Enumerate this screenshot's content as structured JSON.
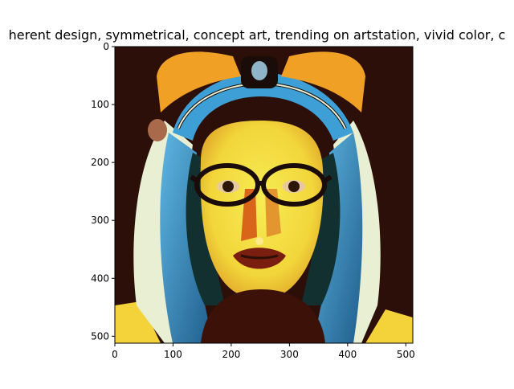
{
  "figure": {
    "title": "herent design, symmetrical,  concept art, trending on artstation, vivid color, c",
    "xticks": [
      "0",
      "100",
      "200",
      "300",
      "400",
      "500"
    ],
    "yticks": [
      "0",
      "100",
      "200",
      "300",
      "400",
      "500"
    ],
    "xlim": [
      0,
      512
    ],
    "ylim": [
      512,
      0
    ],
    "image": {
      "description": "stylized portrait of a woman with round glasses wearing a blue and cream hood with orange goggles",
      "palette": {
        "background": "#2b0f08",
        "skin": "#f2df3a",
        "skin_shadow": "#d9651a",
        "hood_blue": "#3d9fd6",
        "hood_cream": "#e8efd2",
        "goggles": "#f0a024",
        "glasses": "#1a0c08",
        "hair": "#12302f"
      }
    }
  }
}
